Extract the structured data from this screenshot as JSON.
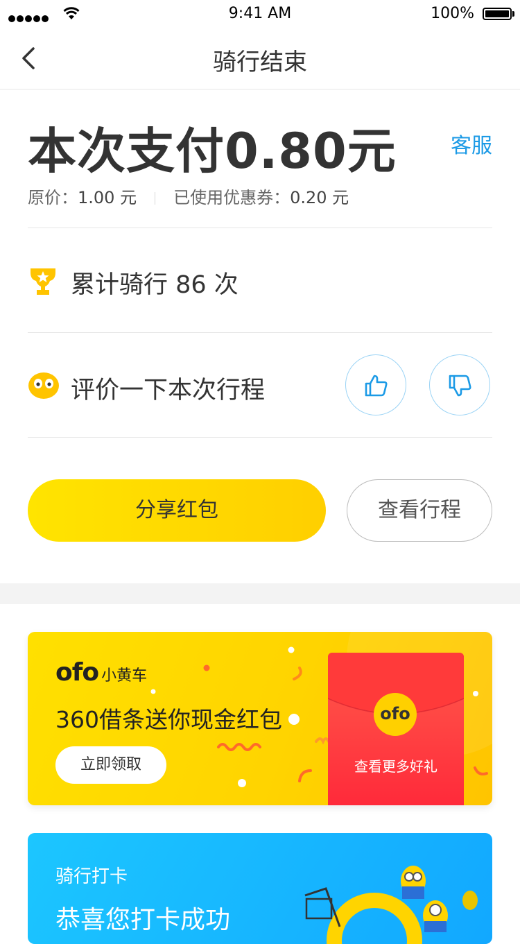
{
  "status_bar": {
    "time": "9:41 AM",
    "battery": "100%"
  },
  "nav": {
    "title": "骑行结束"
  },
  "payment": {
    "title": "本次支付0.80元",
    "service_label": "客服",
    "original_label": "原价：",
    "original_value": "1.00 元",
    "coupon_label": "已使用优惠券：",
    "coupon_value": "0.20 元"
  },
  "stats": {
    "ride_count_text": "累计骑行 86 次"
  },
  "rating": {
    "prompt": "评价一下本次行程"
  },
  "actions": {
    "share_label": "分享红包",
    "view_label": "查看行程"
  },
  "promo": {
    "brand_logo": "ofo",
    "brand_name": "小黄车",
    "headline": "360借条送你现金红包",
    "claim_label": "立即领取",
    "envelope_logo": "ofo",
    "envelope_text": "查看更多好礼"
  },
  "checkin": {
    "small_title": "骑行打卡",
    "big_title": "恭喜您打卡成功"
  },
  "colors": {
    "accent_blue": "#1b9ae6",
    "brand_yellow": "#ffd400"
  }
}
